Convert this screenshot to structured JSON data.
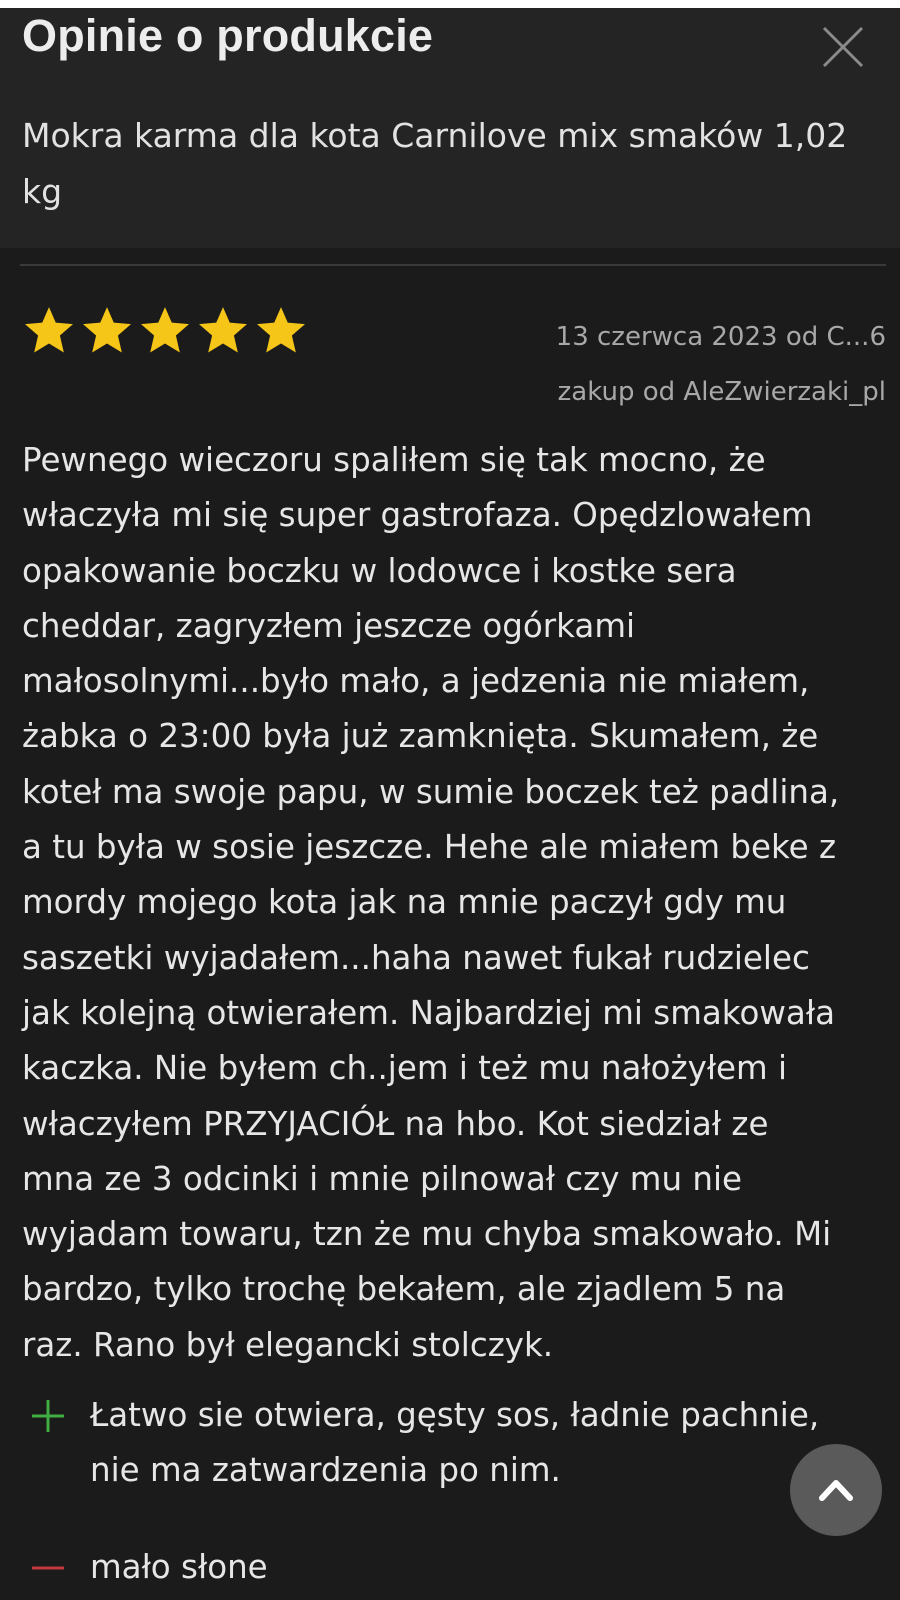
{
  "header": {
    "title": "Opinie o produkcie",
    "product_name": "Mokra karma dla kota Carnilove mix smaków 1,02 kg",
    "close_icon": "close-icon"
  },
  "review": {
    "rating": 5,
    "rating_max": 5,
    "star_color": "#f5c518",
    "date_author": "13 czerwca 2023 od C...6",
    "purchase_source": "zakup od AleZwierzaki_pl",
    "body": "Pewnego wieczoru spaliłem się tak mocno, że\nwłaczyła mi się super gastrofaza. Opędzlowałem\nopakowanie boczku w lodowce i kostke sera\ncheddar, zagryzłem jeszcze ogórkami\nmałosolnymi...było mało, a jedzenia nie miałem,\nżabka o 23:00 była już zamknięta. Skumałem, że\nkoteł ma swoje papu, w sumie boczek też padlina,\na tu była w sosie jeszcze. Hehe ale miałem beke z\nmordy mojego kota jak na mnie paczył gdy mu\nsaszetki wyjadałem...haha nawet fukał rudzielec\njak kolejną otwierałem. Najbardziej mi smakowała\nkaczka. Nie byłem ch..jem i też mu nałożyłem i\nwłaczyłem PRZYJACIÓŁ na hbo. Kot siedział ze\nmna ze 3 odcinki i mnie pilnował czy mu nie\nwyjadam towaru, tzn że mu chyba smakowało. Mi\nbardzo, tylko trochę bekałem, ale zjadlem 5 na\nraz. Rano był elegancki stolczyk.",
    "pros": "Łatwo sie otwiera, gęsty sos, ładnie pachnie, nie ma zatwardzenia po nim.",
    "cons": "mało słone",
    "pro_color": "#3fae3f",
    "con_color": "#c0393b"
  },
  "scroll_top_icon": "chevron-up-icon"
}
